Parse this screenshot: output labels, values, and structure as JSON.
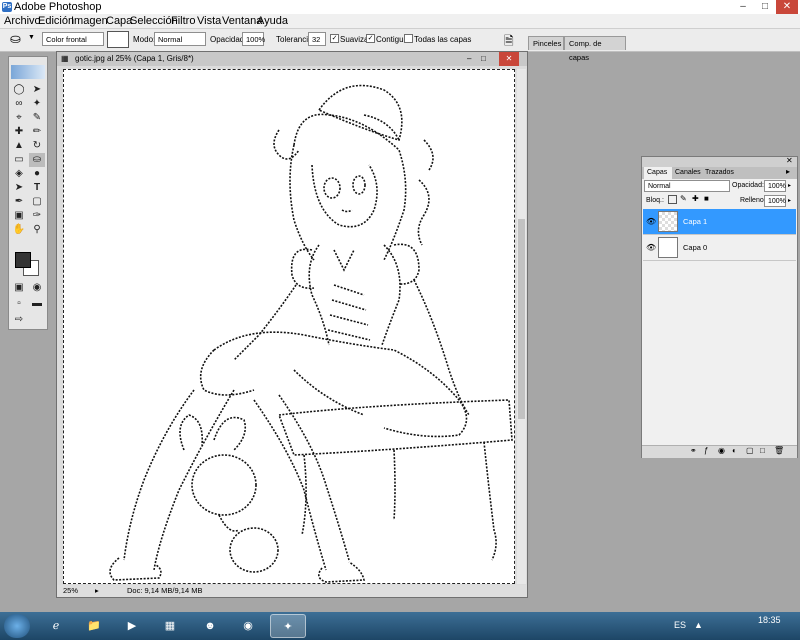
{
  "app": {
    "title": "Adobe Photoshop"
  },
  "menu": [
    "Archivo",
    "Edición",
    "Imagen",
    "Capa",
    "Selección",
    "Filtro",
    "Vista",
    "Ventana",
    "Ayuda"
  ],
  "options": {
    "fill_source": "Color frontal",
    "mode_label": "Modo:",
    "mode_value": "Normal",
    "opacity_label": "Opacidad:",
    "opacity_value": "100%",
    "tolerance_label": "Tolerancia:",
    "tolerance_value": "32",
    "antialias_label": "Suavizar",
    "contiguous_label": "Contiguo",
    "all_layers_label": "Todas las capas"
  },
  "palette_well": {
    "tabs": [
      "Pinceles",
      "Comp. de capas"
    ]
  },
  "document": {
    "title": "gotic.jpg al 25% (Capa 1, Gris/8*)",
    "zoom": "25%",
    "doc_info": "Doc: 9,14 MB/9,14 MB"
  },
  "layers_panel": {
    "tabs": [
      "Capas",
      "Canales",
      "Trazados"
    ],
    "blend_mode": "Normal",
    "opacity_label": "Opacidad:",
    "opacity_value": "100%",
    "lock_label": "Bloq.:",
    "fill_label": "Relleno:",
    "fill_value": "100%",
    "layers": [
      {
        "name": "Capa 1",
        "selected": true
      },
      {
        "name": "Capa 0",
        "selected": false
      }
    ]
  },
  "taskbar": {
    "language": "ES",
    "time": "18:35"
  },
  "colors": {
    "selection": "#3399ff",
    "taskbar": "#2a5780"
  }
}
